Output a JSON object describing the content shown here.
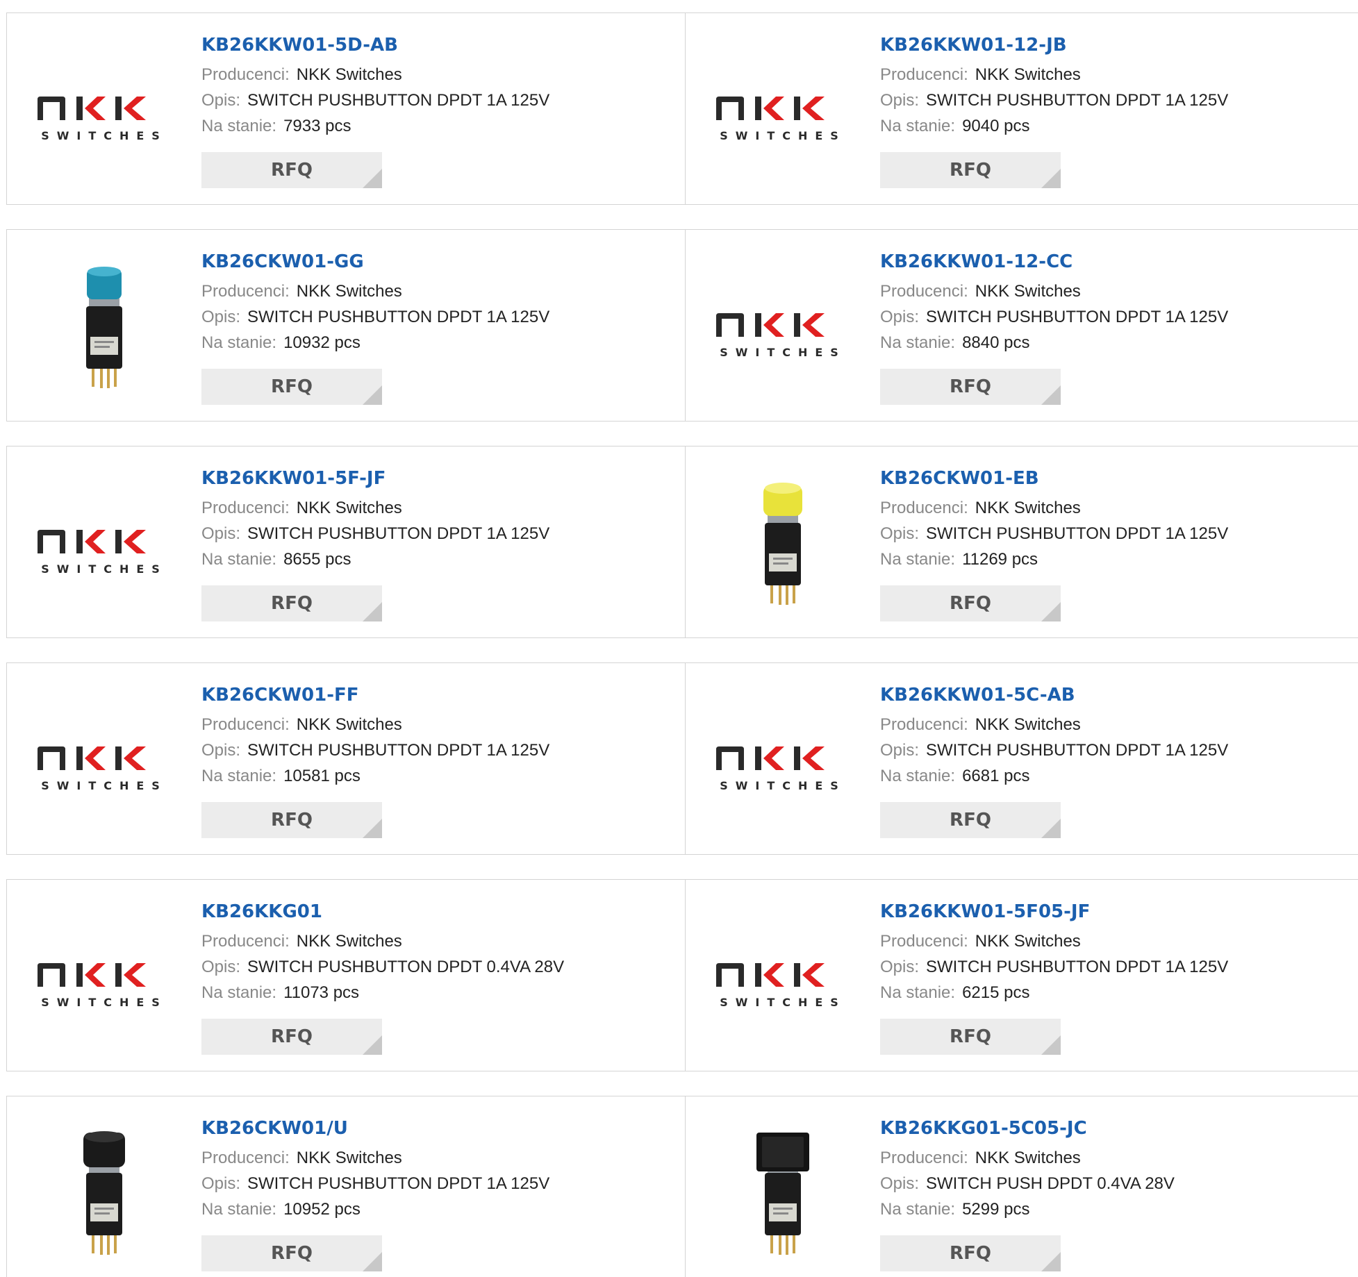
{
  "labels": {
    "manufacturer": "Producenci:",
    "description": "Opis:",
    "stock": "Na stanie:",
    "rfq": "RFQ"
  },
  "logo_text": {
    "brand": "NKK",
    "sub": "SWITCHES"
  },
  "products": [
    {
      "part": "KB26KKW01-5D-AB",
      "manufacturer": "NKK Switches",
      "description": "SWITCH PUSHBUTTON DPDT 1A 125V",
      "stock": "7933 pcs",
      "image": "nkk-logo"
    },
    {
      "part": "KB26KKW01-12-JB",
      "manufacturer": "NKK Switches",
      "description": "SWITCH PUSHBUTTON DPDT 1A 125V",
      "stock": "9040 pcs",
      "image": "nkk-logo"
    },
    {
      "part": "KB26CKW01-GG",
      "manufacturer": "NKK Switches",
      "description": "SWITCH PUSHBUTTON DPDT 1A 125V",
      "stock": "10932 pcs",
      "image": "pushbutton-teal"
    },
    {
      "part": "KB26KKW01-12-CC",
      "manufacturer": "NKK Switches",
      "description": "SWITCH PUSHBUTTON DPDT 1A 125V",
      "stock": "8840 pcs",
      "image": "nkk-logo"
    },
    {
      "part": "KB26KKW01-5F-JF",
      "manufacturer": "NKK Switches",
      "description": "SWITCH PUSHBUTTON DPDT 1A 125V",
      "stock": "8655 pcs",
      "image": "nkk-logo"
    },
    {
      "part": "KB26CKW01-EB",
      "manufacturer": "NKK Switches",
      "description": "SWITCH PUSHBUTTON DPDT 1A 125V",
      "stock": "11269 pcs",
      "image": "pushbutton-yellow"
    },
    {
      "part": "KB26CKW01-FF",
      "manufacturer": "NKK Switches",
      "description": "SWITCH PUSHBUTTON DPDT 1A 125V",
      "stock": "10581 pcs",
      "image": "nkk-logo"
    },
    {
      "part": "KB26KKW01-5C-AB",
      "manufacturer": "NKK Switches",
      "description": "SWITCH PUSHBUTTON DPDT 1A 125V",
      "stock": "6681 pcs",
      "image": "nkk-logo"
    },
    {
      "part": "KB26KKG01",
      "manufacturer": "NKK Switches",
      "description": "SWITCH PUSHBUTTON DPDT 0.4VA 28V",
      "stock": "11073 pcs",
      "image": "nkk-logo"
    },
    {
      "part": "KB26KKW01-5F05-JF",
      "manufacturer": "NKK Switches",
      "description": "SWITCH PUSHBUTTON DPDT 1A 125V",
      "stock": "6215 pcs",
      "image": "nkk-logo"
    },
    {
      "part": "KB26CKW01/U",
      "manufacturer": "NKK Switches",
      "description": "SWITCH PUSHBUTTON DPDT 1A 125V",
      "stock": "10952 pcs",
      "image": "pushbutton-black-round"
    },
    {
      "part": "KB26KKG01-5C05-JC",
      "manufacturer": "NKK Switches",
      "description": "SWITCH PUSH DPDT 0.4VA 28V",
      "stock": "5299 pcs",
      "image": "pushbutton-black-square"
    }
  ]
}
